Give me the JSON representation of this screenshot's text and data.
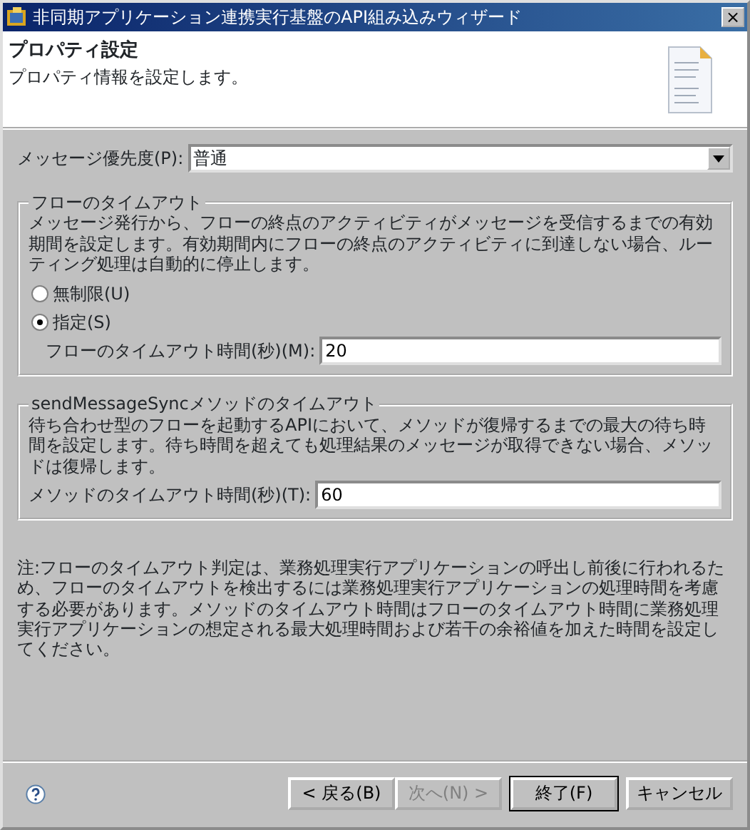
{
  "window": {
    "title": "非同期アプリケーション連携実行基盤のAPI組み込みウィザード",
    "close": "×"
  },
  "header": {
    "title": "プロパティ設定",
    "description": "プロパティ情報を設定します。"
  },
  "priority": {
    "label": "メッセージ優先度(P):",
    "value": "普通"
  },
  "flow_timeout": {
    "legend": "フローのタイムアウト",
    "description": "メッセージ発行から、フローの終点のアクティビティがメッセージを受信するまでの有効期間を設定します。有効期間内にフローの終点のアクティビティに到達しない場合、ルーティング処理は自動的に停止します。",
    "options": [
      {
        "label": "無制限(U)",
        "selected": false
      },
      {
        "label": "指定(S)",
        "selected": true
      }
    ],
    "field": {
      "label": "フローのタイムアウト時間(秒)(M):",
      "value": "20"
    }
  },
  "method_timeout": {
    "legend": "sendMessageSyncメソッドのタイムアウト",
    "description": "待ち合わせ型のフローを起動するAPIにおいて、メソッドが復帰するまでの最大の待ち時間を設定します。待ち時間を超えても処理結果のメッセージが取得できない場合、メソッドは復帰します。",
    "field": {
      "label": "メソッドのタイムアウト時間(秒)(T):",
      "value": "60"
    }
  },
  "note": "注:フローのタイムアウト判定は、業務処理実行アプリケーションの呼出し前後に行われるため、フローのタイムアウトを検出するには業務処理実行アプリケーションの処理時間を考慮する必要があります。メソッドのタイムアウト時間はフローのタイムアウト時間に業務処理実行アプリケーションの想定される最大処理時間および若干の余裕値を加えた時間を設定してください。",
  "buttons": [
    {
      "label": "< 戻る(B)",
      "disabled": false,
      "default": false
    },
    {
      "label": "次へ(N) >",
      "disabled": true,
      "default": false
    },
    {
      "label": "終了(F)",
      "disabled": false,
      "default": true
    },
    {
      "label": "キャンセル",
      "disabled": false,
      "default": false
    }
  ]
}
